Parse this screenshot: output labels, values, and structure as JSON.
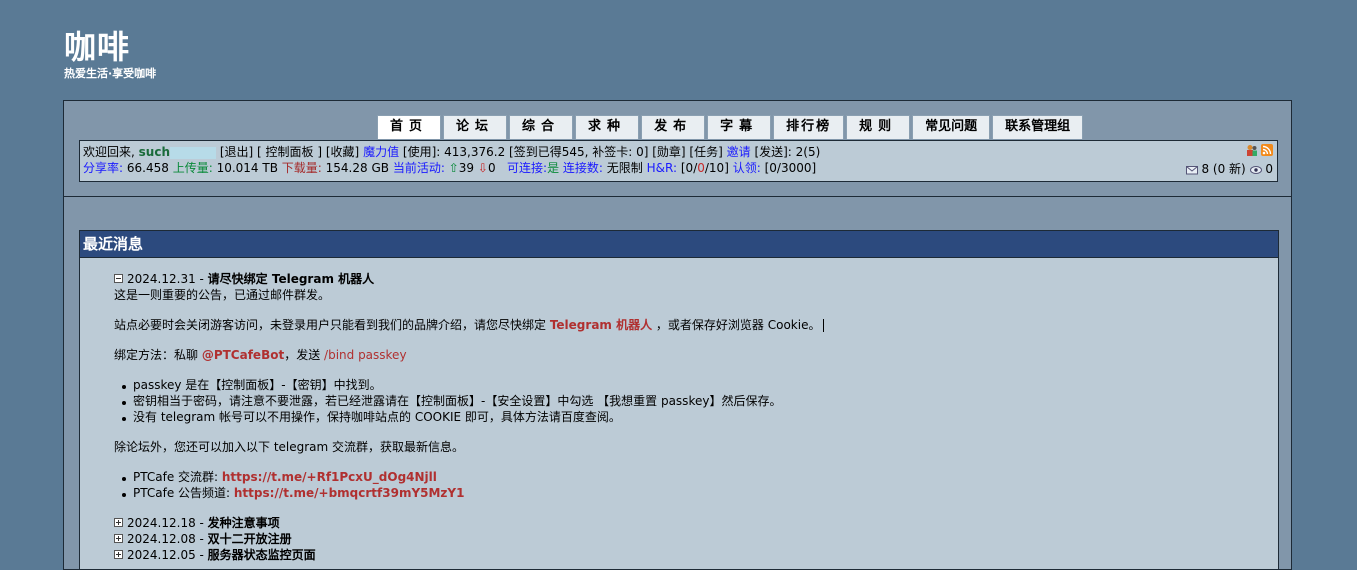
{
  "site": {
    "title": "咖啡",
    "slogan": "热爱生活·享受咖啡"
  },
  "nav": [
    {
      "label": "首页",
      "active": true
    },
    {
      "label": "论坛"
    },
    {
      "label": "综合"
    },
    {
      "label": "求种"
    },
    {
      "label": "发布"
    },
    {
      "label": "字幕"
    },
    {
      "label": "排行榜"
    },
    {
      "label": "规则"
    },
    {
      "label": "常见问题"
    },
    {
      "label": "联系管理组"
    }
  ],
  "userbar": {
    "welcome": "欢迎回来,",
    "username": "such",
    "logout": "[退出]",
    "control_panel": "[ 控制面板 ]",
    "favorites": "[收藏]",
    "bonus_label": "魔力值",
    "bonus_value": "[使用]: 413,376.2 [签到已得545, 补签卡: 0] [勋章] [任务]",
    "invite_label": "邀请",
    "invite_value": "[发送]: 2(5)",
    "ratio_label": "分享率:",
    "ratio_value": "66.458",
    "upload_label": "上传量:",
    "upload_value": "10.014 TB",
    "download_label": "下载量:",
    "download_value": "154.28 GB",
    "active_label": "当前活动:",
    "active_up": "39",
    "active_down": "0",
    "connectable_label": "可连接:",
    "connectable_value": "是",
    "connections_label": "连接数:",
    "connections_value": "无限制",
    "hr_label": "H&R:",
    "hr_value_a": "[0/",
    "hr_value_b": "0",
    "hr_value_c": "/10]",
    "claim_label": "认领:",
    "claim_value": "[0/3000]",
    "messages": "8 (0 新)",
    "watch": "0"
  },
  "news": {
    "header": "最近消息",
    "expanded": {
      "date_title": "2024.12.31 - ",
      "title": "请尽快绑定 Telegram 机器人",
      "line1": "这是一则重要的公告，已通过邮件群发。",
      "line2_a": "站点必要时会关闭游客访问，未登录用户只能看到我们的品牌介绍，请您尽快绑定 ",
      "line2_link": "Telegram 机器人",
      "line2_b": " ，或者保存好浏览器 Cookie。",
      "line3_a": "绑定方法：私聊 ",
      "line3_bot": "@PTCafeBot",
      "line3_b": "，发送 ",
      "line3_cmd": "/bind passkey",
      "bullets": [
        "passkey 是在【控制面板】-【密钥】中找到。",
        "密钥相当于密码，请注意不要泄露，若已经泄露请在【控制面板】-【安全设置】中勾选 【我想重置 passkey】然后保存。",
        "没有 telegram 帐号可以不用操作，保持咖啡站点的 COOKIE 即可，具体方法请百度查阅。"
      ],
      "line4": "除论坛外，您还可以加入以下 telegram 交流群，获取最新信息。",
      "groups": [
        {
          "label": "PTCafe 交流群: ",
          "link": "https://t.me/+Rf1PcxU_dOg4Njll"
        },
        {
          "label": "PTCafe 公告频道: ",
          "link": "https://t.me/+bmqcrtf39mY5MzY1"
        }
      ]
    },
    "collapsed": [
      {
        "date": "2024.12.18 - ",
        "title": "发种注意事项"
      },
      {
        "date": "2024.12.08 - ",
        "title": "双十二开放注册"
      },
      {
        "date": "2024.12.05 - ",
        "title": "服务器状态监控页面"
      }
    ]
  },
  "colors": {
    "background": "#5a7a95",
    "panel": "#bccbd6",
    "header": "#2c4a7e"
  }
}
